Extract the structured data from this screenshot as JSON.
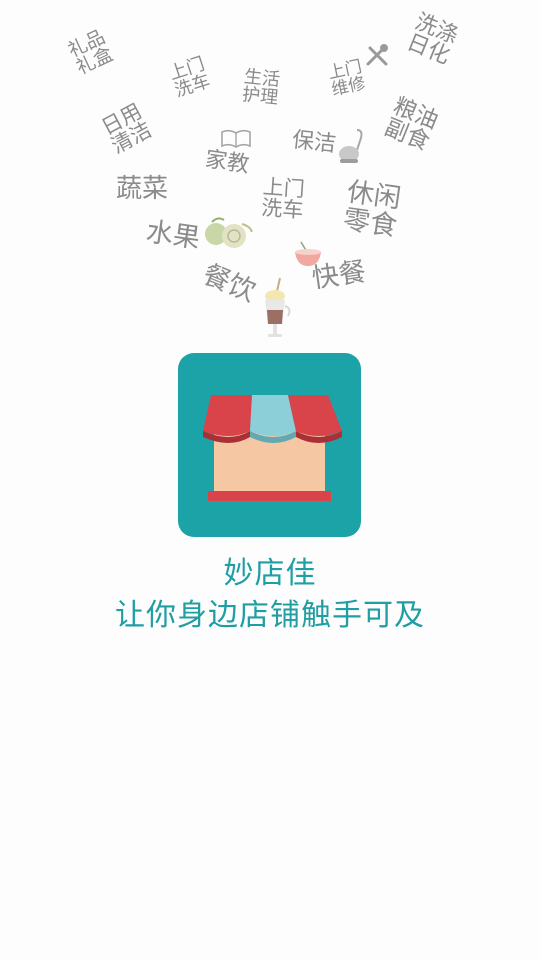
{
  "categories": {
    "gift_box": "礼品\n礼盒",
    "car_wash_top": "上门\n洗车",
    "life_care": "生活\n护理",
    "repair": "上门\n维修",
    "detergent": "洗涤\n日化",
    "daily_cleaning": "日用\n清洁",
    "tutoring": "家教",
    "cleaning": "保洁",
    "grain_oil": "粮油\n副食",
    "vegetables": "蔬菜",
    "car_wash_mid": "上门\n洗车",
    "snacks": "休闲\n零食",
    "fruit": "水果",
    "fast_food": "快餐",
    "dining": "餐饮"
  },
  "icons": {
    "tools": "wrench-screwdriver-icon",
    "book": "book-icon",
    "vacuum": "vacuum-cleaner-icon",
    "fruit": "fruit-icon",
    "bowl": "noodle-bowl-icon",
    "drink": "milkshake-icon",
    "app": "storefront-icon"
  },
  "colors": {
    "brand": "#1ba3a8",
    "text_brand": "#1f9ea3",
    "word": "#8b8b8b",
    "awning_red": "#d9434a",
    "awning_blue": "#8ccfd8",
    "wall": "#f5c7a2"
  },
  "app": {
    "name": "妙店佳",
    "slogan": "让你身边店铺触手可及"
  }
}
